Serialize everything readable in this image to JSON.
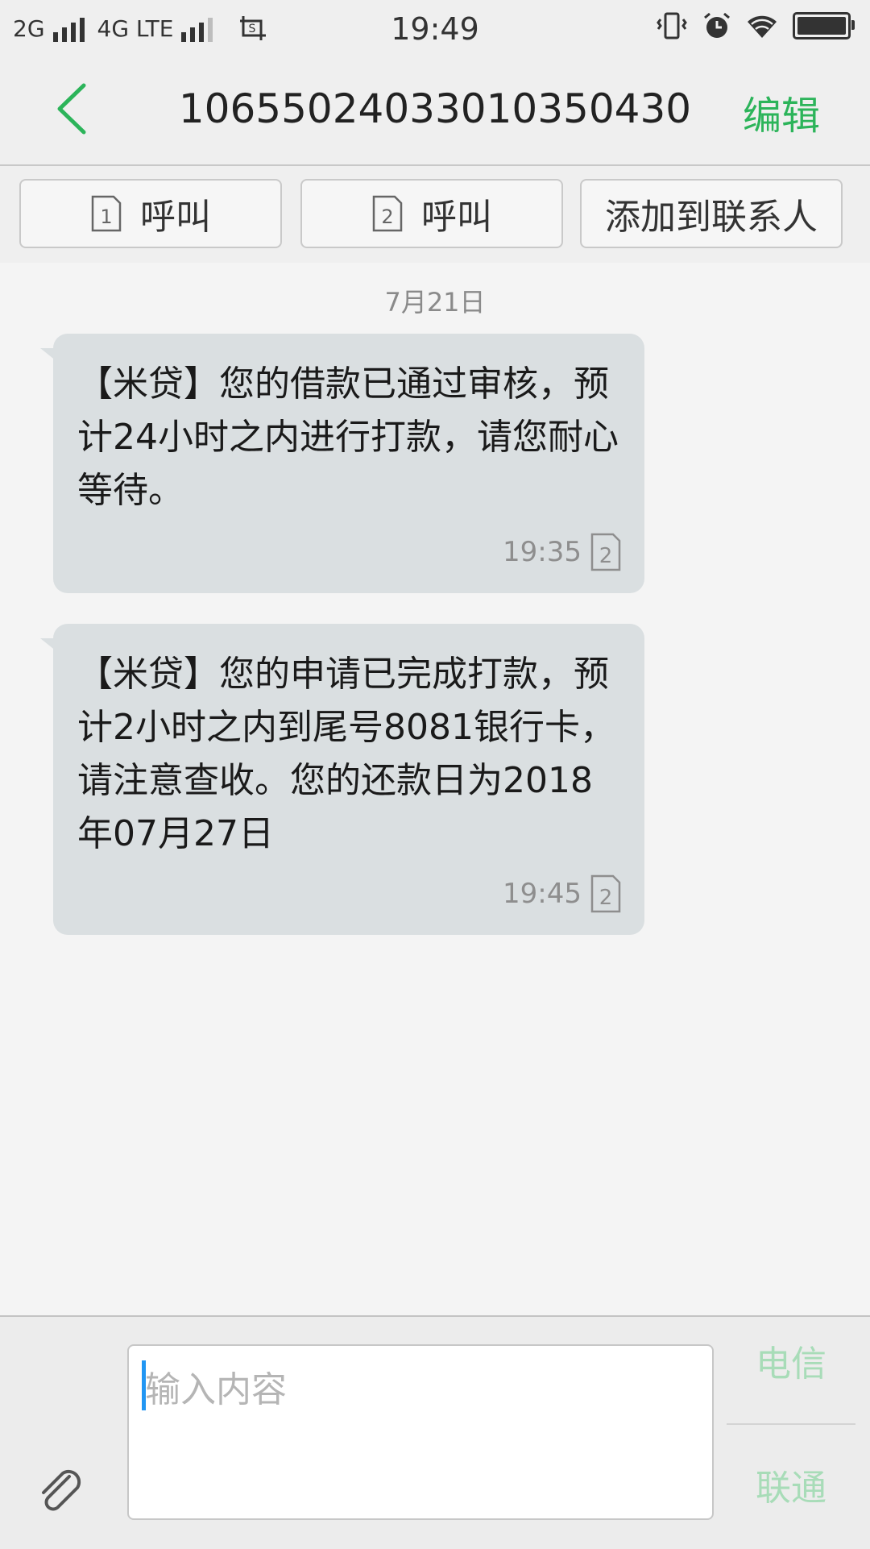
{
  "status_bar": {
    "left_text_1": "2G",
    "left_text_2": "4G LTE",
    "time": "19:49"
  },
  "header": {
    "title": "10655024033010350430",
    "edit_label": "编辑"
  },
  "actions": {
    "call_sim1_label": "呼叫",
    "call_sim2_label": "呼叫",
    "add_contact_label": "添加到联系人",
    "sim1_number": "1",
    "sim2_number": "2"
  },
  "conversation": {
    "date": "7月21日",
    "messages": [
      {
        "text": "【米贷】您的借款已通过审核，预计24小时之内进行打款，请您耐心等待。",
        "time": "19:35",
        "sim": "2"
      },
      {
        "text": "【米贷】您的申请已完成打款，预计2小时之内到尾号8081银行卡，请注意查收。您的还款日为2018年07月27日",
        "time": "19:45",
        "sim": "2"
      }
    ]
  },
  "composer": {
    "placeholder": "输入内容",
    "send_sim1_label": "电信",
    "send_sim2_label": "联通"
  },
  "colors": {
    "accent": "#2cb45a",
    "accent_disabled": "#a8dcb8",
    "bubble": "#dadfe1",
    "caret": "#2196f3"
  }
}
